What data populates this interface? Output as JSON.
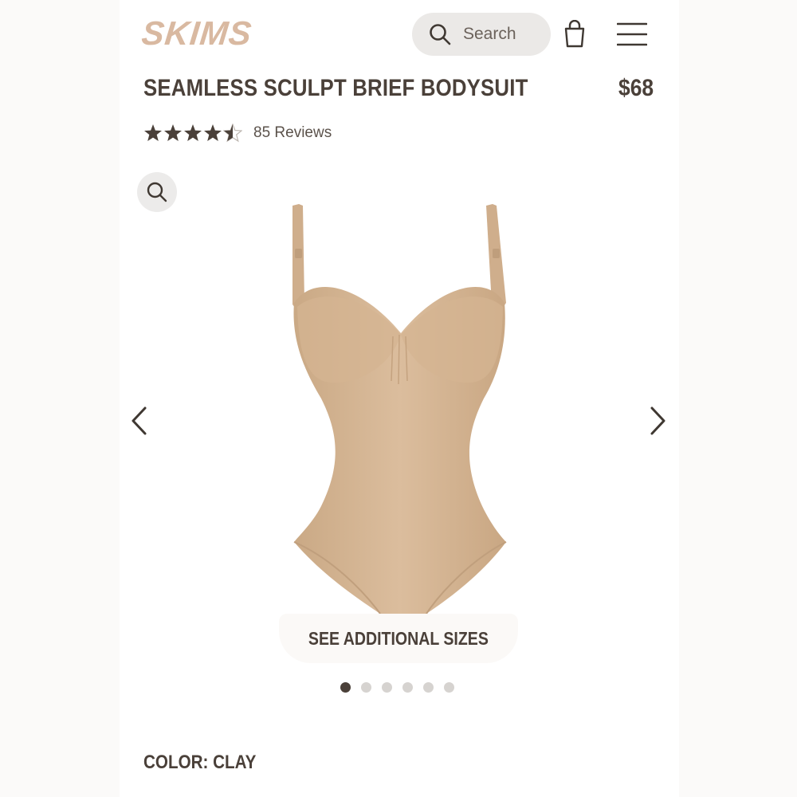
{
  "header": {
    "logo": "SKIMS",
    "search_placeholder": "Search"
  },
  "product": {
    "title": "SEAMLESS SCULPT BRIEF BODYSUIT",
    "price": "$68",
    "rating": 4.5,
    "reviews_label": "85 Reviews",
    "see_sizes_label": "SEE ADDITIONAL SIZES",
    "color_label": "COLOR: CLAY"
  },
  "carousel": {
    "total_images": 6,
    "active_index": 0
  },
  "colors": {
    "logo": "#d9b9a1",
    "text": "#4a4039",
    "product": "#d8b999"
  },
  "icons": {
    "search": "search-icon",
    "bag": "shopping-bag-icon",
    "menu": "hamburger-menu-icon",
    "zoom": "zoom-icon",
    "prev": "chevron-left-icon",
    "next": "chevron-right-icon",
    "star": "star-icon"
  }
}
